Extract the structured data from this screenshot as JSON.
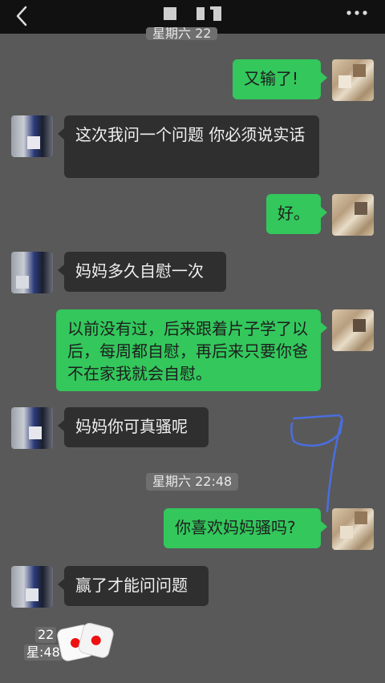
{
  "header": {
    "back_icon": "chevron-left-icon",
    "more_icon": "more-dots-icon"
  },
  "timestamps": {
    "top_partial": "星期六 22",
    "middle": "星期六 22:48"
  },
  "messages": [
    {
      "side": "right",
      "text": "又输了!"
    },
    {
      "side": "left",
      "text": "这次我问一个问题 你必须说实话"
    },
    {
      "side": "right",
      "text": "好。"
    },
    {
      "side": "left",
      "text": "妈妈多久自慰一次"
    },
    {
      "side": "right",
      "text": "以前没有过，后来跟着片子学了以后，每周都自慰，再后来只要你爸不在家我就会自慰。"
    },
    {
      "side": "left",
      "text": "妈妈你可真骚呢"
    },
    {
      "side": "right",
      "text": "你喜欢妈妈骚吗?"
    },
    {
      "side": "left",
      "text": "赢了才能问问题"
    }
  ],
  "bottom_overlay": {
    "line1": "22",
    "line2": "星:48"
  },
  "colors": {
    "background": "#595959",
    "sent_bubble": "#33c75c",
    "received_bubble": "#2f2f2f",
    "topbar": "#111111",
    "annotation_stroke": "#4a6ee0"
  }
}
